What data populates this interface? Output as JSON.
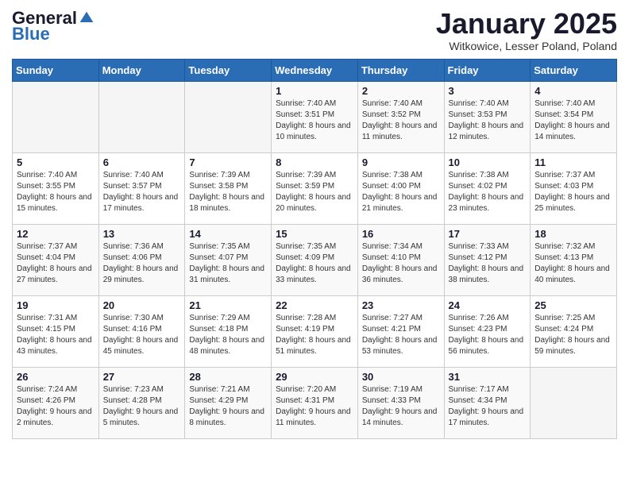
{
  "header": {
    "logo_general": "General",
    "logo_blue": "Blue",
    "title": "January 2025",
    "location": "Witkowice, Lesser Poland, Poland"
  },
  "days_of_week": [
    "Sunday",
    "Monday",
    "Tuesday",
    "Wednesday",
    "Thursday",
    "Friday",
    "Saturday"
  ],
  "weeks": [
    [
      {
        "day": "",
        "info": ""
      },
      {
        "day": "",
        "info": ""
      },
      {
        "day": "",
        "info": ""
      },
      {
        "day": "1",
        "info": "Sunrise: 7:40 AM\nSunset: 3:51 PM\nDaylight: 8 hours\nand 10 minutes."
      },
      {
        "day": "2",
        "info": "Sunrise: 7:40 AM\nSunset: 3:52 PM\nDaylight: 8 hours\nand 11 minutes."
      },
      {
        "day": "3",
        "info": "Sunrise: 7:40 AM\nSunset: 3:53 PM\nDaylight: 8 hours\nand 12 minutes."
      },
      {
        "day": "4",
        "info": "Sunrise: 7:40 AM\nSunset: 3:54 PM\nDaylight: 8 hours\nand 14 minutes."
      }
    ],
    [
      {
        "day": "5",
        "info": "Sunrise: 7:40 AM\nSunset: 3:55 PM\nDaylight: 8 hours\nand 15 minutes."
      },
      {
        "day": "6",
        "info": "Sunrise: 7:40 AM\nSunset: 3:57 PM\nDaylight: 8 hours\nand 17 minutes."
      },
      {
        "day": "7",
        "info": "Sunrise: 7:39 AM\nSunset: 3:58 PM\nDaylight: 8 hours\nand 18 minutes."
      },
      {
        "day": "8",
        "info": "Sunrise: 7:39 AM\nSunset: 3:59 PM\nDaylight: 8 hours\nand 20 minutes."
      },
      {
        "day": "9",
        "info": "Sunrise: 7:38 AM\nSunset: 4:00 PM\nDaylight: 8 hours\nand 21 minutes."
      },
      {
        "day": "10",
        "info": "Sunrise: 7:38 AM\nSunset: 4:02 PM\nDaylight: 8 hours\nand 23 minutes."
      },
      {
        "day": "11",
        "info": "Sunrise: 7:37 AM\nSunset: 4:03 PM\nDaylight: 8 hours\nand 25 minutes."
      }
    ],
    [
      {
        "day": "12",
        "info": "Sunrise: 7:37 AM\nSunset: 4:04 PM\nDaylight: 8 hours\nand 27 minutes."
      },
      {
        "day": "13",
        "info": "Sunrise: 7:36 AM\nSunset: 4:06 PM\nDaylight: 8 hours\nand 29 minutes."
      },
      {
        "day": "14",
        "info": "Sunrise: 7:35 AM\nSunset: 4:07 PM\nDaylight: 8 hours\nand 31 minutes."
      },
      {
        "day": "15",
        "info": "Sunrise: 7:35 AM\nSunset: 4:09 PM\nDaylight: 8 hours\nand 33 minutes."
      },
      {
        "day": "16",
        "info": "Sunrise: 7:34 AM\nSunset: 4:10 PM\nDaylight: 8 hours\nand 36 minutes."
      },
      {
        "day": "17",
        "info": "Sunrise: 7:33 AM\nSunset: 4:12 PM\nDaylight: 8 hours\nand 38 minutes."
      },
      {
        "day": "18",
        "info": "Sunrise: 7:32 AM\nSunset: 4:13 PM\nDaylight: 8 hours\nand 40 minutes."
      }
    ],
    [
      {
        "day": "19",
        "info": "Sunrise: 7:31 AM\nSunset: 4:15 PM\nDaylight: 8 hours\nand 43 minutes."
      },
      {
        "day": "20",
        "info": "Sunrise: 7:30 AM\nSunset: 4:16 PM\nDaylight: 8 hours\nand 45 minutes."
      },
      {
        "day": "21",
        "info": "Sunrise: 7:29 AM\nSunset: 4:18 PM\nDaylight: 8 hours\nand 48 minutes."
      },
      {
        "day": "22",
        "info": "Sunrise: 7:28 AM\nSunset: 4:19 PM\nDaylight: 8 hours\nand 51 minutes."
      },
      {
        "day": "23",
        "info": "Sunrise: 7:27 AM\nSunset: 4:21 PM\nDaylight: 8 hours\nand 53 minutes."
      },
      {
        "day": "24",
        "info": "Sunrise: 7:26 AM\nSunset: 4:23 PM\nDaylight: 8 hours\nand 56 minutes."
      },
      {
        "day": "25",
        "info": "Sunrise: 7:25 AM\nSunset: 4:24 PM\nDaylight: 8 hours\nand 59 minutes."
      }
    ],
    [
      {
        "day": "26",
        "info": "Sunrise: 7:24 AM\nSunset: 4:26 PM\nDaylight: 9 hours\nand 2 minutes."
      },
      {
        "day": "27",
        "info": "Sunrise: 7:23 AM\nSunset: 4:28 PM\nDaylight: 9 hours\nand 5 minutes."
      },
      {
        "day": "28",
        "info": "Sunrise: 7:21 AM\nSunset: 4:29 PM\nDaylight: 9 hours\nand 8 minutes."
      },
      {
        "day": "29",
        "info": "Sunrise: 7:20 AM\nSunset: 4:31 PM\nDaylight: 9 hours\nand 11 minutes."
      },
      {
        "day": "30",
        "info": "Sunrise: 7:19 AM\nSunset: 4:33 PM\nDaylight: 9 hours\nand 14 minutes."
      },
      {
        "day": "31",
        "info": "Sunrise: 7:17 AM\nSunset: 4:34 PM\nDaylight: 9 hours\nand 17 minutes."
      },
      {
        "day": "",
        "info": ""
      }
    ]
  ]
}
